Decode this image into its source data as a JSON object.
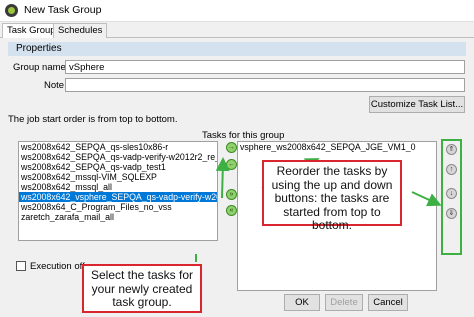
{
  "window": {
    "title": "New Task Group"
  },
  "tabs": [
    {
      "label": "Task Group"
    },
    {
      "label": "Schedules"
    }
  ],
  "properties": {
    "header": "Properties",
    "group_name_label": "Group name:",
    "group_name_value": "vSphere",
    "note_label": "Note:",
    "note_value": "",
    "customize_button": "Customize Task List..."
  },
  "order_note": "The job start order is from top to bottom.",
  "tasks_header": "Tasks for this group",
  "available_tasks": [
    "ws2008x642_SEPQA_qs-sles10x86-r",
    "ws2008x642_SEPQA_qs-vadp-verify-w2012r2_re_a",
    "ws2008x642_SEPQA_qs-vadp_test1",
    "ws2008x642_mssql-VIM_SQLEXP",
    "ws2008x642_mssql_all",
    "ws2008x642_vsphere_SEPQA_qs-vadp-verify-w201",
    "ws2008x64_C_Program_Files_no_vss",
    "zaretch_zarafa_mail_all"
  ],
  "selected_index": 5,
  "group_tasks": [
    "vsphere_ws2008x642_SEPQA_JGE_VM1_0"
  ],
  "execution_off_label": "Execution off",
  "callouts": {
    "reorder": "Reorder the tasks by using the up and down buttons: the tasks are started from top to bottom.",
    "select": "Select the tasks for your newly created task group."
  },
  "buttons": {
    "ok": "OK",
    "delete": "Delete",
    "cancel": "Cancel"
  },
  "colors": {
    "callout_border": "#d9262e",
    "highlight_green": "#3cb043",
    "selection": "#0078d7"
  }
}
